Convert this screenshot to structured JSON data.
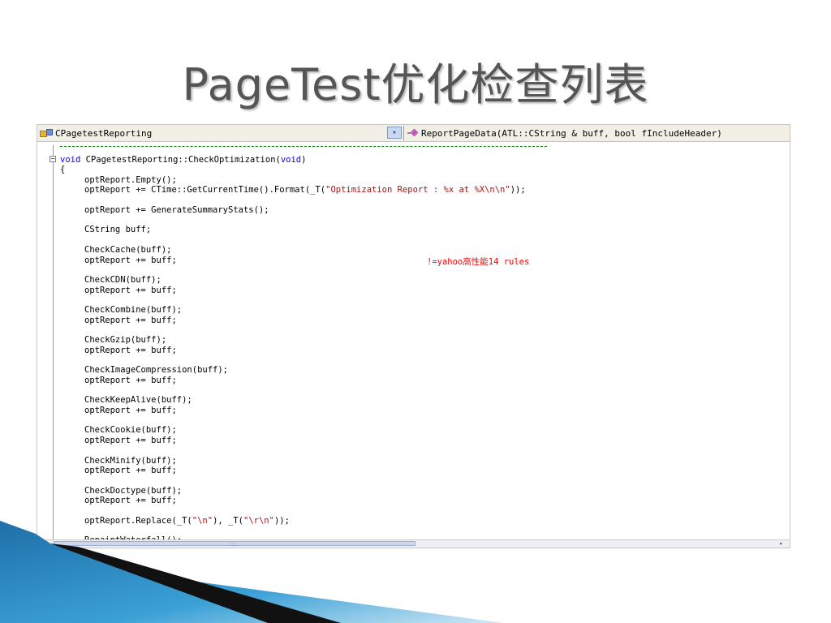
{
  "slide": {
    "title": "PageTest优化检查列表"
  },
  "ide": {
    "class_combo": "CPagetestReporting",
    "class_combo_arrow": "▾",
    "method_combo": "ReportPageData(ATL::CString & buff, bool fIncludeHeader)",
    "annotation": "!=yahoo高性能14 rules",
    "scroll_grip": "::::",
    "scroll_right": "▸",
    "code": [
      {
        "indent": 0,
        "parts": [
          {
            "t": "void",
            "c": "kw"
          },
          {
            "t": " CPagetestReporting::CheckOptimization("
          },
          {
            "t": "void",
            "c": "kw"
          },
          {
            "t": ")"
          }
        ]
      },
      {
        "indent": 0,
        "parts": [
          {
            "t": "{"
          }
        ]
      },
      {
        "indent": 1,
        "parts": [
          {
            "t": "optReport.Empty();"
          }
        ]
      },
      {
        "indent": 1,
        "parts": [
          {
            "t": "optReport += CTime::GetCurrentTime().Format(_T("
          },
          {
            "t": "\"Optimization Report : %x at %X\\n\\n\"",
            "c": "str"
          },
          {
            "t": "));"
          }
        ]
      },
      {
        "indent": 1,
        "parts": [
          {
            "t": ""
          }
        ]
      },
      {
        "indent": 1,
        "parts": [
          {
            "t": "optReport += GenerateSummaryStats();"
          }
        ]
      },
      {
        "indent": 1,
        "parts": [
          {
            "t": ""
          }
        ]
      },
      {
        "indent": 1,
        "parts": [
          {
            "t": "CString buff;"
          }
        ]
      },
      {
        "indent": 1,
        "parts": [
          {
            "t": ""
          }
        ]
      },
      {
        "indent": 1,
        "parts": [
          {
            "t": "CheckCache(buff);"
          }
        ]
      },
      {
        "indent": 1,
        "parts": [
          {
            "t": "optReport += buff;"
          }
        ]
      },
      {
        "indent": 1,
        "parts": [
          {
            "t": ""
          }
        ]
      },
      {
        "indent": 1,
        "parts": [
          {
            "t": "CheckCDN(buff);"
          }
        ]
      },
      {
        "indent": 1,
        "parts": [
          {
            "t": "optReport += buff;"
          }
        ]
      },
      {
        "indent": 1,
        "parts": [
          {
            "t": ""
          }
        ]
      },
      {
        "indent": 1,
        "parts": [
          {
            "t": "CheckCombine(buff);"
          }
        ]
      },
      {
        "indent": 1,
        "parts": [
          {
            "t": "optReport += buff;"
          }
        ]
      },
      {
        "indent": 1,
        "parts": [
          {
            "t": ""
          }
        ]
      },
      {
        "indent": 1,
        "parts": [
          {
            "t": "CheckGzip(buff);"
          }
        ]
      },
      {
        "indent": 1,
        "parts": [
          {
            "t": "optReport += buff;"
          }
        ]
      },
      {
        "indent": 1,
        "parts": [
          {
            "t": ""
          }
        ]
      },
      {
        "indent": 1,
        "parts": [
          {
            "t": "CheckImageCompression(buff);"
          }
        ]
      },
      {
        "indent": 1,
        "parts": [
          {
            "t": "optReport += buff;"
          }
        ]
      },
      {
        "indent": 1,
        "parts": [
          {
            "t": ""
          }
        ]
      },
      {
        "indent": 1,
        "parts": [
          {
            "t": "CheckKeepAlive(buff);"
          }
        ]
      },
      {
        "indent": 1,
        "parts": [
          {
            "t": "optReport += buff;"
          }
        ]
      },
      {
        "indent": 1,
        "parts": [
          {
            "t": ""
          }
        ]
      },
      {
        "indent": 1,
        "parts": [
          {
            "t": "CheckCookie(buff);"
          }
        ]
      },
      {
        "indent": 1,
        "parts": [
          {
            "t": "optReport += buff;"
          }
        ]
      },
      {
        "indent": 1,
        "parts": [
          {
            "t": ""
          }
        ]
      },
      {
        "indent": 1,
        "parts": [
          {
            "t": "CheckMinify(buff);"
          }
        ]
      },
      {
        "indent": 1,
        "parts": [
          {
            "t": "optReport += buff;"
          }
        ]
      },
      {
        "indent": 1,
        "parts": [
          {
            "t": ""
          }
        ]
      },
      {
        "indent": 1,
        "parts": [
          {
            "t": "CheckDoctype(buff);"
          }
        ]
      },
      {
        "indent": 1,
        "parts": [
          {
            "t": "optReport += buff;"
          }
        ]
      },
      {
        "indent": 1,
        "parts": [
          {
            "t": ""
          }
        ]
      },
      {
        "indent": 1,
        "parts": [
          {
            "t": "optReport.Replace(_T("
          },
          {
            "t": "\"\\n\"",
            "c": "str"
          },
          {
            "t": "), _T("
          },
          {
            "t": "\"\\r\\n\"",
            "c": "str"
          },
          {
            "t": "));"
          }
        ]
      },
      {
        "indent": 1,
        "parts": [
          {
            "t": ""
          }
        ]
      },
      {
        "indent": 1,
        "parts": [
          {
            "t": "RepaintWaterfall();"
          }
        ]
      }
    ]
  },
  "colors": {
    "keyword": "#0000ff",
    "string": "#a31515",
    "annotation": "#ff0000",
    "title": "#555555",
    "deco_dark": "#111111",
    "deco_blue": "#3aa0d6"
  }
}
